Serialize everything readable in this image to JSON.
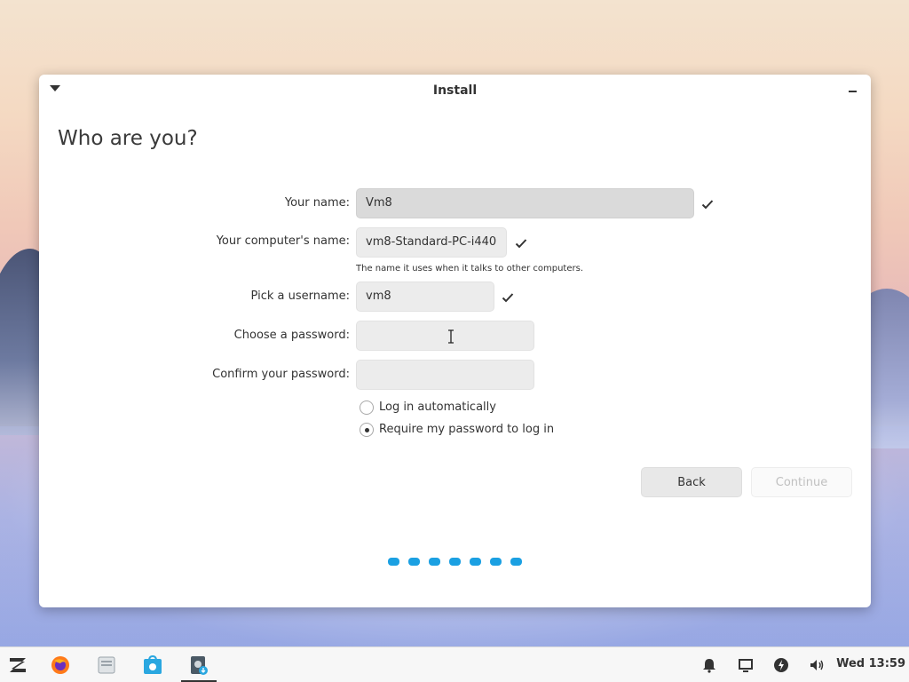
{
  "window": {
    "title": "Install",
    "page_title": "Who are you?"
  },
  "form": {
    "name_label": "Your name:",
    "name_value": "Vm8",
    "computer_label": "Your computer's name:",
    "computer_value": "vm8-Standard-PC-i440",
    "computer_hint": "The name it uses when it talks to other computers.",
    "username_label": "Pick a username:",
    "username_value": "vm8",
    "password_label": "Choose a password:",
    "password_value": "",
    "confirm_label": "Confirm your password:",
    "confirm_value": ""
  },
  "login_options": [
    {
      "label": "Log in automatically",
      "selected": false
    },
    {
      "label": "Require my password to log in",
      "selected": true
    }
  ],
  "buttons": {
    "back": "Back",
    "continue": "Continue"
  },
  "progress": {
    "total_steps": 7
  },
  "taskbar": {
    "apps": [
      "zorin-menu-icon",
      "firefox-icon",
      "files-icon",
      "software-store-icon",
      "installer-icon"
    ],
    "clock": "Wed 13:59"
  },
  "colors": {
    "accent": "#1ba0e2",
    "window_bg": "#ffffff",
    "field_bg": "#ececec"
  }
}
